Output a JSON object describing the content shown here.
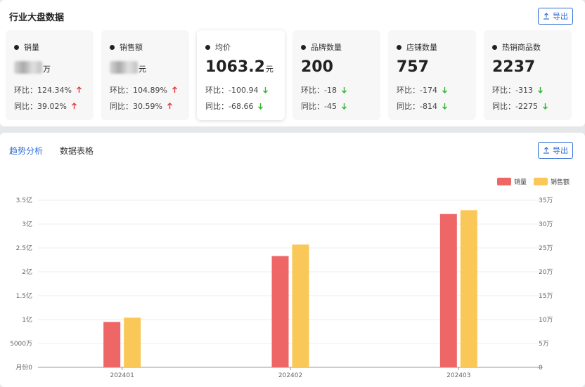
{
  "header": {
    "title": "行业大盘数据",
    "export_label": "导出"
  },
  "cards": [
    {
      "name": "销量",
      "value": "",
      "unit": "万",
      "blurred": true,
      "hb_label": "环比：",
      "hb": "124.34%",
      "hb_dir": "up",
      "tb_label": "同比：",
      "tb": "39.02%",
      "tb_dir": "up"
    },
    {
      "name": "销售额",
      "value": "",
      "unit": "元",
      "blurred": true,
      "hb_label": "环比：",
      "hb": "104.89%",
      "hb_dir": "up",
      "tb_label": "同比：",
      "tb": "30.59%",
      "tb_dir": "up"
    },
    {
      "name": "均价",
      "value": "1063.2",
      "unit": "元",
      "blurred": false,
      "hb_label": "环比：",
      "hb": "-100.94",
      "hb_dir": "down",
      "tb_label": "同比：",
      "tb": "-68.66",
      "tb_dir": "down"
    },
    {
      "name": "品牌数量",
      "value": "200",
      "unit": "",
      "blurred": false,
      "hb_label": "环比：",
      "hb": "-18",
      "hb_dir": "down",
      "tb_label": "同比：",
      "tb": "-45",
      "tb_dir": "down"
    },
    {
      "name": "店铺数量",
      "value": "757",
      "unit": "",
      "blurred": false,
      "hb_label": "环比：",
      "hb": "-174",
      "hb_dir": "down",
      "tb_label": "同比：",
      "tb": "-814",
      "tb_dir": "down"
    },
    {
      "name": "热销商品数",
      "value": "2237",
      "unit": "",
      "blurred": false,
      "hb_label": "环比：",
      "hb": "-313",
      "hb_dir": "down",
      "tb_label": "同比：",
      "tb": "-2275",
      "tb_dir": "down"
    }
  ],
  "tabs": [
    {
      "label": "趋势分析",
      "active": true
    },
    {
      "label": "数据表格",
      "active": false
    }
  ],
  "colors": {
    "accent": "#2f6ed4",
    "up": "#e03b3b",
    "down": "#2eb82e",
    "series_sales": "#ee6666",
    "series_revenue": "#fac858"
  },
  "chart_data": {
    "type": "bar",
    "categories": [
      "202401",
      "202402",
      "202403"
    ],
    "series": [
      {
        "name": "销量",
        "axis": "left",
        "values": [
          0.95,
          2.33,
          3.21
        ]
      },
      {
        "name": "销售额",
        "axis": "right",
        "values": [
          10.4,
          25.7,
          32.9
        ]
      }
    ],
    "left_axis": {
      "ticks": [
        "月份0",
        "5000万",
        "1亿",
        "1.5亿",
        "2亿",
        "2.5亿",
        "3亿",
        "3.5亿"
      ],
      "ylim": [
        0,
        3.5
      ]
    },
    "right_axis": {
      "ticks": [
        "0",
        "5万",
        "10万",
        "15万",
        "20万",
        "25万",
        "30万",
        "35万"
      ],
      "ylim": [
        0,
        35
      ]
    },
    "legend_placement": "top-right",
    "grid": true
  }
}
